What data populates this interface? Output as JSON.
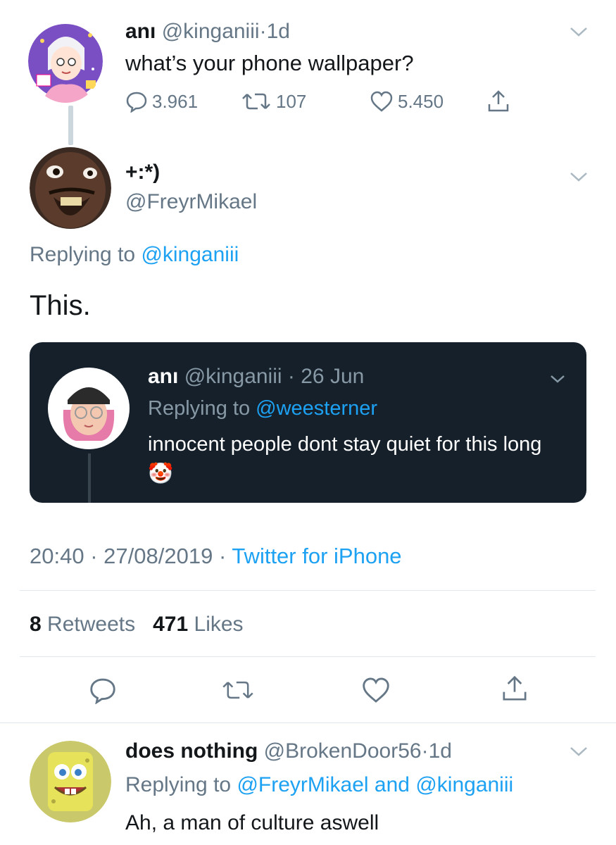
{
  "tweet1": {
    "name": "anı",
    "handle": "@kinganiii",
    "dot": "·",
    "age": "1d",
    "text": "what’s your phone wallpaper?",
    "replies": "3.961",
    "retweets": "107",
    "likes": "5.450",
    "avatar_icon": "anime-girl-avatar"
  },
  "tweet2": {
    "name": "+:*)",
    "handle": "@FreyrMikael",
    "replying_prefix": "Replying to",
    "replying_to": "@kinganiii",
    "text": "This.",
    "avatar_icon": "face-closeup-avatar"
  },
  "quoted_card": {
    "name": "anı",
    "handle": "@kinganiii",
    "dot": "·",
    "date": "26 Jun",
    "replying_prefix": "Replying to",
    "replying_to": "@weesterner",
    "text": "innocent people dont stay quiet for this long",
    "emoji": "🤡",
    "avatar_icon": "memoji-avatar"
  },
  "meta": {
    "time": "20:40",
    "sep1": "·",
    "date": "27/08/2019",
    "sep2": "·",
    "source": "Twitter for iPhone"
  },
  "stats": {
    "retweets_count": "8",
    "retweets_label": "Retweets",
    "likes_count": "471",
    "likes_label": "Likes"
  },
  "tweet3": {
    "name": "does nothing",
    "handle": "@BrokenDoor56",
    "dot": "·",
    "age": "1d",
    "replying_prefix": "Replying to",
    "replying_to_1": "@FreyrMikael",
    "and": "and",
    "replying_to_2": "@kinganiii",
    "text": "Ah, a man of culture aswell",
    "avatar_icon": "spongebob-avatar"
  },
  "colors": {
    "link_blue": "#1da1f2",
    "secondary_gray": "#657786",
    "card_bg": "#15202b"
  }
}
